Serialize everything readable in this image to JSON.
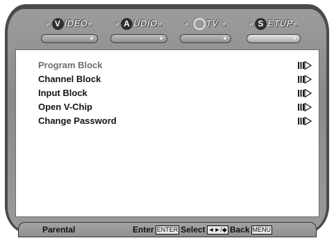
{
  "tabs": [
    {
      "letter": "V",
      "label": "IDEO",
      "circle": "filled",
      "active": false
    },
    {
      "letter": "A",
      "label": "UDIO",
      "circle": "filled",
      "active": false
    },
    {
      "letter": "",
      "label": "TV",
      "circle": "hollow",
      "active": false
    },
    {
      "letter": "S",
      "label": "ETUP",
      "circle": "filled",
      "active": true
    }
  ],
  "tab_bracket_left": "«",
  "tab_bracket_right": "»",
  "menu": [
    {
      "label": "Program Block",
      "highlight": true
    },
    {
      "label": "Channel Block",
      "highlight": false
    },
    {
      "label": "Input Block",
      "highlight": false
    },
    {
      "label": "Open V-Chip",
      "highlight": false
    },
    {
      "label": "Change Password",
      "highlight": false
    }
  ],
  "footer": {
    "title": "Parental",
    "enter_label": "Enter",
    "enter_key": "ENTER",
    "select_label": "Select",
    "select_key": "◄►/◆",
    "back_label": "Back",
    "back_key": "MENU"
  },
  "colors": {
    "frame": "#4a4a4a",
    "menu_text": "#141414",
    "menu_highlight_text": "#6e6e6e"
  },
  "icons": {
    "menu_arrow": "submenu-arrow-icon"
  }
}
